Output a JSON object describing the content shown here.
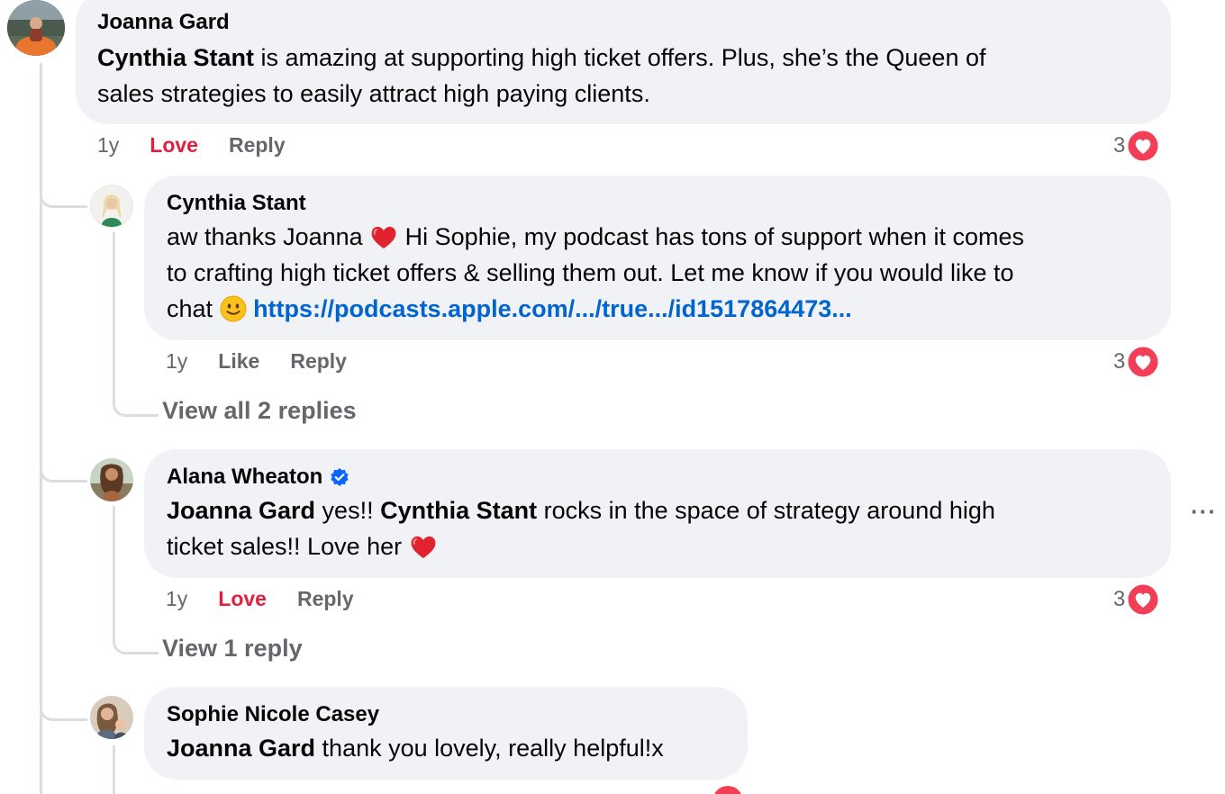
{
  "comments": [
    {
      "author": "Joanna Gard",
      "body": {
        "mention": "Cynthia Stant",
        "text_line1": " is amazing at supporting high ticket offers. Plus, she’s the Queen of",
        "text_line2": "sales strategies to easily attract high paying clients."
      },
      "time": "1y",
      "like_label": "Love",
      "reply_label": "Reply",
      "reaction_count": "3"
    },
    {
      "author": "Cynthia Stant",
      "body": {
        "line1_a": "aw thanks Joanna ",
        "line1_b": " Hi Sophie, my podcast has tons of support when it comes",
        "line2": "to crafting high ticket offers & selling them out. Let me know if you would like to",
        "line3_a": "chat ",
        "link": "https://podcasts.apple.com/.../true.../id1517864473..."
      },
      "time": "1y",
      "like_label": "Like",
      "reply_label": "Reply",
      "reaction_count": "3",
      "view_replies": "View all 2 replies"
    },
    {
      "author": "Alana Wheaton",
      "verified": true,
      "body": {
        "mention1": "Joanna Gard",
        "text1": " yes!! ",
        "mention2": "Cynthia Stant",
        "text2": " rocks in the space of strategy around high",
        "line2": "ticket sales!! Love her "
      },
      "time": "1y",
      "like_label": "Love",
      "reply_label": "Reply",
      "reaction_count": "3",
      "view_replies": "View 1 reply",
      "more_label": "···"
    },
    {
      "author": "Sophie Nicole Casey",
      "body": {
        "mention": "Joanna Gard",
        "text": " thank you lovely, really helpful!x"
      }
    }
  ],
  "colors": {
    "bubble": "#f0f2f5",
    "link": "#0064d1",
    "love": "#e41e3f",
    "meta": "#65676b",
    "thread_line": "#dadde1",
    "verified": "#0866ff"
  },
  "icons": {
    "heart_emoji": "red-heart-emoji",
    "smile_emoji": "slightly-smiling-face-emoji",
    "reaction": "love-reaction-icon",
    "verified": "verified-badge-icon",
    "more": "more-options-icon"
  }
}
